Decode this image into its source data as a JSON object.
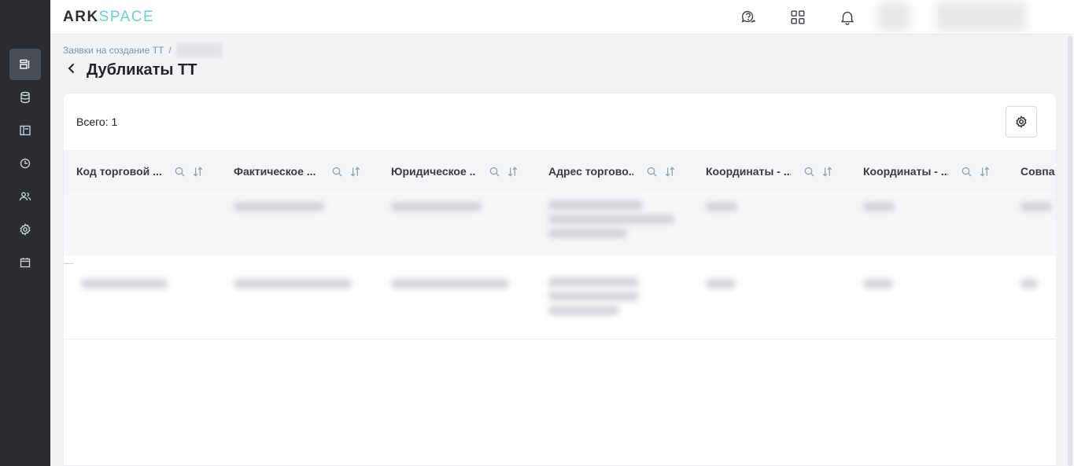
{
  "app": {
    "logo_primary": "ARK",
    "logo_secondary": "SPACE"
  },
  "sidebar": {
    "items": [
      {
        "icon": "requests-icon",
        "active": true
      },
      {
        "icon": "database-icon",
        "active": false
      },
      {
        "icon": "layout-icon",
        "active": false
      },
      {
        "icon": "clock-icon",
        "active": false
      },
      {
        "icon": "users-icon",
        "active": false
      },
      {
        "icon": "gear-icon",
        "active": false
      },
      {
        "icon": "calendar-icon",
        "active": false
      }
    ]
  },
  "header": {
    "icons": [
      "support-chat-icon",
      "apps-grid-icon",
      "bell-icon"
    ]
  },
  "breadcrumb": {
    "parent": "Заявки на создание ТТ",
    "separator": "/"
  },
  "page": {
    "title": "Дубликаты ТТ"
  },
  "table": {
    "total_label": "Всего: 1",
    "columns": [
      {
        "label": "Код торговой ..."
      },
      {
        "label": "Фактическое ..."
      },
      {
        "label": "Юридическое ..."
      },
      {
        "label": "Адрес торгово..."
      },
      {
        "label": "Координаты - ..."
      },
      {
        "label": "Координаты - ..."
      },
      {
        "label": "Совпа"
      }
    ]
  }
}
